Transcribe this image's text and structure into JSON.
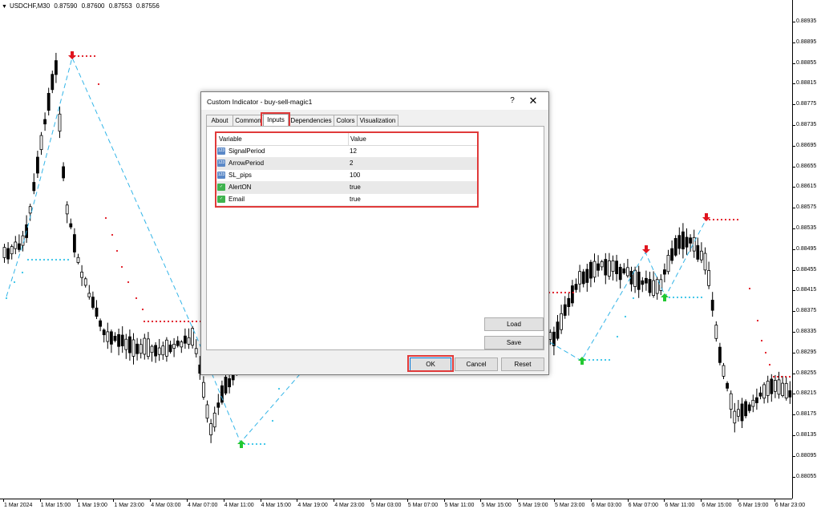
{
  "chart": {
    "symbol": "USDCHF,M30",
    "ohlc": [
      "0.87590",
      "0.87600",
      "0.87553",
      "0.87556"
    ],
    "price_labels": [
      "0.88935",
      "0.88895",
      "0.88855",
      "0.88815",
      "0.88775",
      "0.88735",
      "0.88695",
      "0.88655",
      "0.88615",
      "0.88575",
      "0.88535",
      "0.88495",
      "0.88455",
      "0.88415",
      "0.88375",
      "0.88335",
      "0.88295",
      "0.88255",
      "0.88215",
      "0.88175",
      "0.88135",
      "0.88095",
      "0.88055"
    ],
    "time_labels": [
      "1 Mar 2024",
      "1 Mar 15:00",
      "1 Mar 19:00",
      "1 Mar 23:00",
      "4 Mar 03:00",
      "4 Mar 07:00",
      "4 Mar 11:00",
      "4 Mar 15:00",
      "4 Mar 19:00",
      "4 Mar 23:00",
      "5 Mar 03:00",
      "5 Mar 07:00",
      "5 Mar 11:00",
      "5 Mar 15:00",
      "5 Mar 19:00",
      "5 Mar 23:00",
      "6 Mar 03:00",
      "6 Mar 07:00",
      "6 Mar 11:00",
      "6 Mar 15:00",
      "6 Mar 19:00",
      "6 Mar 23:00"
    ],
    "colors": {
      "buy_arrow": "#22c832",
      "sell_arrow": "#e0141e",
      "buy_dots": "#33c3e8",
      "sell_dots": "#e0141e",
      "zigzag": "#33b5e8",
      "candles": "#000000"
    }
  },
  "dialog": {
    "title": "Custom Indicator - buy-sell-magic1",
    "help": "?",
    "close": "✕",
    "tabs": [
      "About",
      "Common",
      "Inputs",
      "Dependencies",
      "Colors",
      "Visualization"
    ],
    "active_tab": "Inputs",
    "table": {
      "headers": [
        "Variable",
        "Value"
      ],
      "rows": [
        {
          "icon": "123",
          "name": "SignalPeriod",
          "value": "12"
        },
        {
          "icon": "123",
          "name": "ArrowPeriod",
          "value": "2"
        },
        {
          "icon": "123",
          "name": "SL_pips",
          "value": "100"
        },
        {
          "icon": "bool",
          "name": "AlertON",
          "value": "true"
        },
        {
          "icon": "bool",
          "name": "Email",
          "value": "true"
        }
      ]
    },
    "buttons": {
      "load": "Load",
      "save": "Save",
      "ok": "OK",
      "cancel": "Cancel",
      "reset": "Reset"
    }
  }
}
